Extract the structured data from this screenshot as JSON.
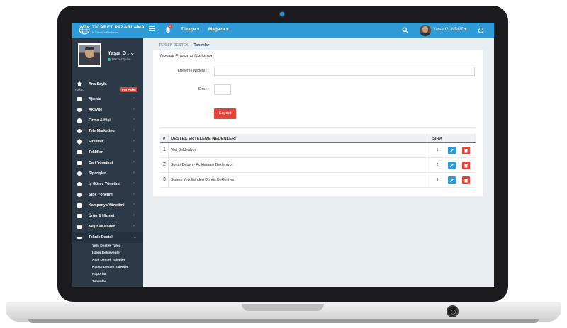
{
  "topbar": {
    "logo_title": "TİCARET PAZARLAMA",
    "logo_sub": "İş Yönetim Platformu",
    "notif_count": "6",
    "language": "Türkçe ▾",
    "store": "Mağaza ▾",
    "user": "Yaşar GÜNDÜZ ▾"
  },
  "profile": {
    "name": "Yaşar G . ⌄",
    "branch": "Merkez Şube"
  },
  "sidebar": {
    "home": {
      "label": "Ana Sayfa",
      "sub": "Paket",
      "badge": "Pro Paket"
    },
    "items": [
      {
        "label": "Ajanda"
      },
      {
        "label": "Aktivite"
      },
      {
        "label": "Firma & Kişi"
      },
      {
        "label": "Tele Marketing"
      },
      {
        "label": "Fırsatlar"
      },
      {
        "label": "Teklifler"
      },
      {
        "label": "Cari Yönetimi"
      },
      {
        "label": "Siparişler"
      },
      {
        "label": "İş Görev Yönetimi"
      },
      {
        "label": "Stok Yönetimi"
      },
      {
        "label": "Kampanya Yönetimi"
      },
      {
        "label": "Ürün & Hizmet"
      },
      {
        "label": "Keşif ve Analiz"
      },
      {
        "label": "Teknik Destek"
      }
    ],
    "subitems": [
      "Yeni Destek Talep",
      "İşlem Bekleyenler",
      "Açık Destek Talepler",
      "Kapalı Destek Talepler",
      "Raporlar",
      "Tanımlar"
    ]
  },
  "breadcrumb": {
    "parent": "TEKNİK DESTEK",
    "sep": "›",
    "current": "Tanımlar"
  },
  "form": {
    "title": "Destek Erteleme Nedenleri",
    "reason_label": "Erteleme Nedeni :",
    "reason_value": "",
    "order_label": "Sıra :",
    "order_value": "",
    "save_label": "Kaydet"
  },
  "table": {
    "headers": {
      "no": "#",
      "name": "DESTEK ERTELEME NEDENLERİ",
      "sira": "SIRA"
    },
    "rows": [
      {
        "no": "1",
        "name": "Veri Bekleniyor",
        "sira": "1"
      },
      {
        "no": "2",
        "name": "Sorun Detayı - Açıklaması Bekleniyor.",
        "sira": "2"
      },
      {
        "no": "3",
        "name": "Sistem Yetkilisinden Dönüş Bekleniyor",
        "sira": "3"
      }
    ]
  },
  "colors": {
    "accent": "#2f9bd7",
    "danger": "#e4433a",
    "sidebar": "#2c3947"
  }
}
